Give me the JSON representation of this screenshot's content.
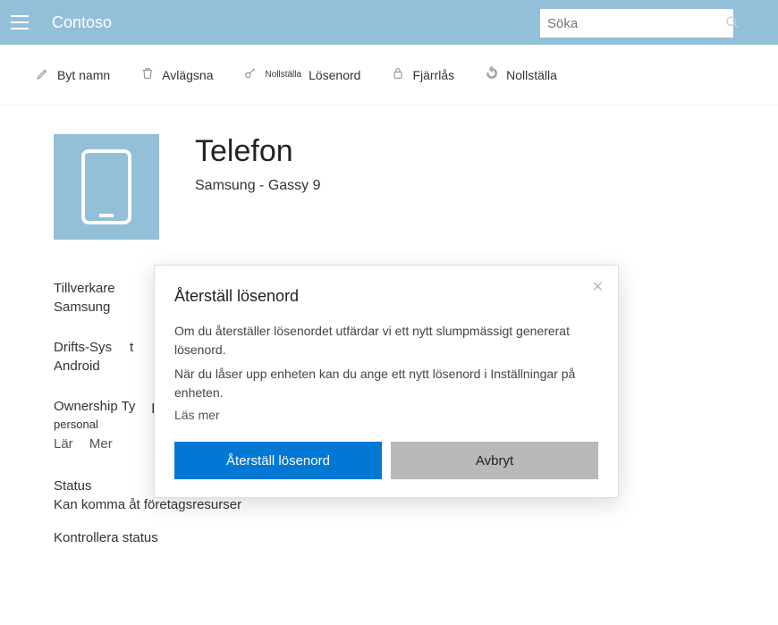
{
  "header": {
    "brand": "Contoso",
    "search_placeholder": "Söka"
  },
  "actions": {
    "rename": "Byt namn",
    "remove": "Avlägsna",
    "reset_pw_small": "Nollställa",
    "reset_pw": "Lösenord",
    "remote_lock": "Fjärrlås",
    "reset": "Nollställa"
  },
  "device": {
    "title": "Telefon",
    "subtitle": "Samsung - Gassy 9"
  },
  "info": {
    "manufacturer_label": "Tillverkare",
    "manufacturer_value": "Samsung",
    "os_label": "Drifts-Sys",
    "os_label_tail": "t",
    "os_value": "Android",
    "ownership_label": "Ownership Ty",
    "ownership_tail": "p",
    "ownership_value": "personal",
    "learn": "Lär",
    "more": "Mer",
    "status_label": "Status",
    "status_value": "Kan komma åt företagsresurser",
    "check_status": "Kontrollera status"
  },
  "dialog": {
    "title": "Återställ lösenord",
    "body1": "Om du återställer lösenordet utfärdar vi ett nytt slumpmässigt genererat lösenord.",
    "body2": "När du låser upp enheten kan du ange ett nytt lösenord i Inställningar på enheten.",
    "learn_more": "Läs mer",
    "confirm": "Återställ lösenord",
    "cancel": "Avbryt"
  }
}
